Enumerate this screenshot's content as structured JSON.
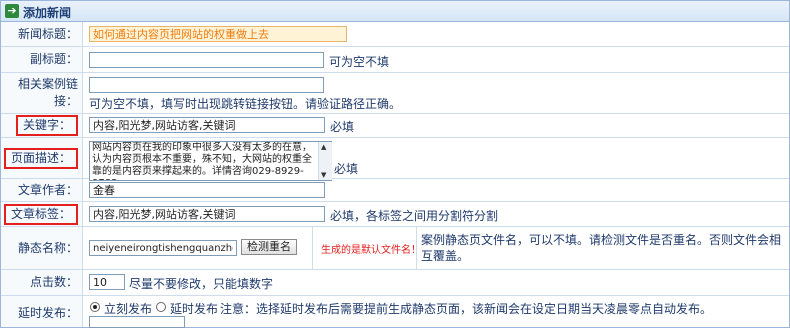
{
  "header": {
    "icon": "arrow-right-icon",
    "title": "添加新闻"
  },
  "title_row": {
    "label": "新闻标题：",
    "value": "如何通过内容页把网站的权重做上去"
  },
  "subtitle_row": {
    "label": "副标题：",
    "value": "",
    "hint": "可为空不填"
  },
  "link_row": {
    "label_line1": "相关案例链",
    "label_line2": "接：",
    "value": "",
    "hint": "可为空不填，填写时出现跳转链接按钮。请验证路径正确。"
  },
  "keywords_row": {
    "label": "关键字：",
    "value": "内容,阳光梦,网站访客,关键词",
    "hint": "必填"
  },
  "desc_row": {
    "label": "页面描述：",
    "value": "网站内容页在我的印象中很多人没有太多的在意，认为内容页根本不重要，殊不知，大网站的权重全靠的是内容页来撑起来的。详情咨询029-8929-9783",
    "hint": "必填"
  },
  "author_row": {
    "label": "文章作者：",
    "value": "金春"
  },
  "tags_row": {
    "label": "文章标签：",
    "value": "内容,阳光梦,网站访客,关键词",
    "hint": "必填，各标签之间用分割符分割"
  },
  "static_row": {
    "label": "静态名称：",
    "value": "neiyeneirongtishengquanzhong",
    "button": "检测重名",
    "default_note": "生成的是默认文件名！",
    "hint": "案例静态页文件名，可以不填。请检测文件是否重名。否则文件会相互覆盖。"
  },
  "clicks_row": {
    "label": "点击数：",
    "value": "10",
    "hint": "尽量不要修改，只能填数字"
  },
  "publish_row": {
    "label": "延时发布：",
    "option_now": "立刻发布",
    "option_delay": "延时发布",
    "note": "注意：选择延时发布后需要提前生成静态页面，该新闻会在设定日期当天凌晨零点自动发布。"
  },
  "colors": {
    "label_text": "#1f3a6b",
    "highlight": "#e51e1e",
    "title_input_bg": "#fff3d6",
    "title_input_text": "#f07d12",
    "border": "#9bb6d8"
  }
}
